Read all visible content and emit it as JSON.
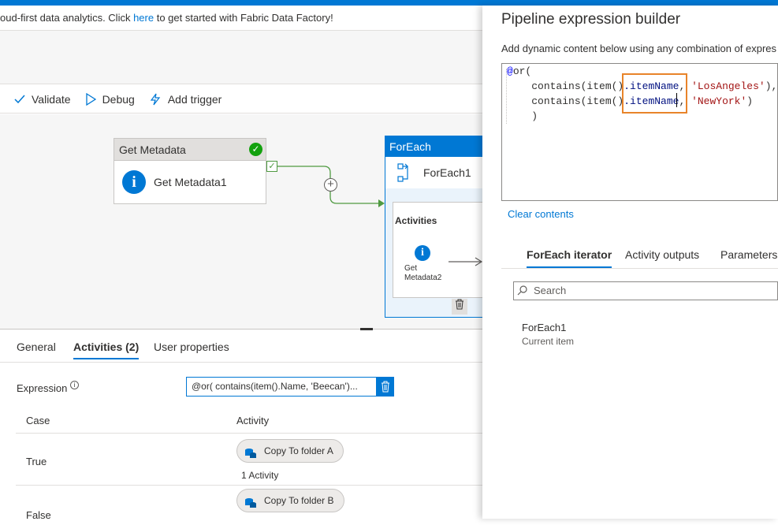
{
  "banner": {
    "text_before": "oud-first data analytics. Click ",
    "link": "here",
    "text_after": " to get started with Fabric Data Factory!"
  },
  "toolbar": {
    "validate": "Validate",
    "debug": "Debug",
    "add_trigger": "Add trigger"
  },
  "canvas": {
    "get_metadata": {
      "header": "Get Metadata",
      "name": "Get Metadata1"
    },
    "foreach": {
      "header": "ForEach",
      "name": "ForEach1",
      "activities_label": "Activities",
      "inner_line1": "Get",
      "inner_line2": "Metadata2"
    }
  },
  "bottom": {
    "tabs": [
      "General",
      "Activities (2)",
      "User properties"
    ],
    "expression_label": "Expression",
    "expression_value": "@or( contains(item().Name, 'Beecan')...",
    "col_case": "Case",
    "col_activity": "Activity",
    "rows": [
      {
        "case": "True",
        "chip": "Copy To folder A",
        "count": "1 Activity"
      },
      {
        "case": "False",
        "chip": "Copy To folder B"
      }
    ]
  },
  "panel": {
    "title": "Pipeline expression builder",
    "description": "Add dynamic content below using any combination of expres",
    "code": {
      "l1_at": "@",
      "l1_fn": "or(",
      "fn_contains": "contains(item()",
      "prop": ".itemName",
      "sep": ", ",
      "s1": "'LosAngeles'",
      "t1": "),",
      "s2": "'NewYork'",
      "t2": ")",
      "l4": ")"
    },
    "clear": "Clear contents",
    "tabs": [
      "ForEach iterator",
      "Activity outputs",
      "Parameters"
    ],
    "search_placeholder": "Search",
    "item_name": "ForEach1",
    "item_desc": "Current item"
  },
  "colors": {
    "accent": "#0078d4",
    "highlight": "#e8842a",
    "success": "#13a10e"
  }
}
